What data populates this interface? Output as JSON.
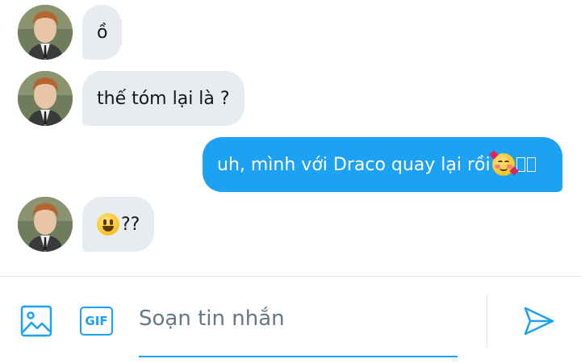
{
  "messages": [
    {
      "direction": "incoming",
      "text": "ồ"
    },
    {
      "direction": "incoming",
      "text": "thế tóm lại là ?"
    },
    {
      "direction": "outgoing",
      "text": "uh, mình với Draco quay lại rồi",
      "emoji": "smiling-face-with-hearts"
    },
    {
      "direction": "incoming",
      "text": "??",
      "emoji": "grinning-face"
    }
  ],
  "composer": {
    "placeholder": "Soạn tin nhắn",
    "gif_label": "GIF",
    "icons": [
      "image-icon",
      "gif-icon",
      "send-icon"
    ]
  },
  "colors": {
    "accent": "#1da1f2",
    "incoming_bubble": "#e6ecf0",
    "outgoing_text": "#ffffff"
  }
}
